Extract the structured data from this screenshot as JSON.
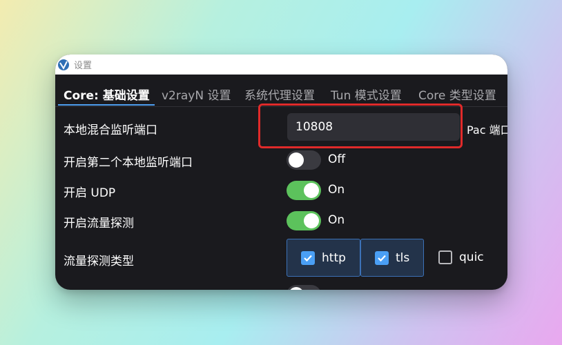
{
  "window": {
    "title": "设置"
  },
  "tabs": [
    {
      "label": "Core: 基础设置",
      "active": true
    },
    {
      "label": "v2rayN 设置",
      "active": false
    },
    {
      "label": "系统代理设置",
      "active": false
    },
    {
      "label": "Tun 模式设置",
      "active": false
    },
    {
      "label": "Core 类型设置",
      "active": false
    }
  ],
  "settings": {
    "local_port": {
      "label": "本地混合监听端口",
      "value": "10808"
    },
    "pac_label": "Pac 端口",
    "second_port": {
      "label": "开启第二个本地监听端口",
      "state": "Off"
    },
    "udp": {
      "label": "开启 UDP",
      "state": "On"
    },
    "sniffing": {
      "label": "开启流量探测",
      "state": "On"
    },
    "sniff_type": {
      "label": "流量探测类型",
      "options": [
        {
          "label": "http",
          "checked": true
        },
        {
          "label": "tls",
          "checked": true
        },
        {
          "label": "quic",
          "checked": false
        }
      ]
    }
  },
  "colors": {
    "accent": "#4e9ff0",
    "toggle_on": "#5cc25c",
    "highlight": "#e02a2a"
  }
}
